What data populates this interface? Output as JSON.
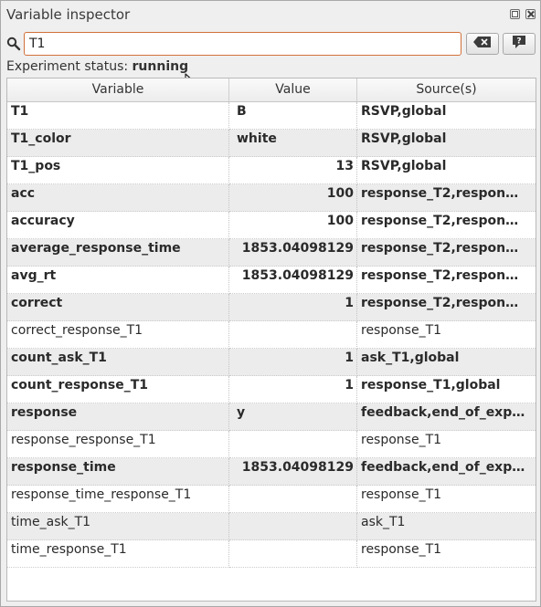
{
  "window": {
    "title": "Variable inspector"
  },
  "search": {
    "value": "T1"
  },
  "status": {
    "label": "Experiment status:",
    "value": "running"
  },
  "table": {
    "headers": [
      "Variable",
      "Value",
      "Source(s)"
    ],
    "rows": [
      {
        "variable": "T1",
        "value": "B",
        "sources": "RSVP,global",
        "bold": true,
        "numeric": false
      },
      {
        "variable": "T1_color",
        "value": "white",
        "sources": "RSVP,global",
        "bold": true,
        "numeric": false
      },
      {
        "variable": "T1_pos",
        "value": "13",
        "sources": "RSVP,global",
        "bold": true,
        "numeric": true
      },
      {
        "variable": "acc",
        "value": "100",
        "sources": "response_T2,respon…",
        "bold": true,
        "numeric": true
      },
      {
        "variable": "accuracy",
        "value": "100",
        "sources": "response_T2,respon…",
        "bold": true,
        "numeric": true
      },
      {
        "variable": "average_response_time",
        "value": "1853.04098129",
        "sources": "response_T2,respon…",
        "bold": true,
        "numeric": true
      },
      {
        "variable": "avg_rt",
        "value": "1853.04098129",
        "sources": "response_T2,respon…",
        "bold": true,
        "numeric": true
      },
      {
        "variable": "correct",
        "value": "1",
        "sources": "response_T2,respon…",
        "bold": true,
        "numeric": true
      },
      {
        "variable": "correct_response_T1",
        "value": "",
        "sources": "response_T1",
        "bold": false,
        "numeric": false
      },
      {
        "variable": "count_ask_T1",
        "value": "1",
        "sources": "ask_T1,global",
        "bold": true,
        "numeric": true
      },
      {
        "variable": "count_response_T1",
        "value": "1",
        "sources": "response_T1,global",
        "bold": true,
        "numeric": true
      },
      {
        "variable": "response",
        "value": "y",
        "sources": "feedback,end_of_exp…",
        "bold": true,
        "numeric": false
      },
      {
        "variable": "response_response_T1",
        "value": "",
        "sources": "response_T1",
        "bold": false,
        "numeric": false
      },
      {
        "variable": "response_time",
        "value": "1853.04098129",
        "sources": "feedback,end_of_exp…",
        "bold": true,
        "numeric": true
      },
      {
        "variable": "response_time_response_T1",
        "value": "",
        "sources": "response_T1",
        "bold": false,
        "numeric": false
      },
      {
        "variable": "time_ask_T1",
        "value": "",
        "sources": "ask_T1",
        "bold": false,
        "numeric": false
      },
      {
        "variable": "time_response_T1",
        "value": "",
        "sources": "response_T1",
        "bold": false,
        "numeric": false
      }
    ]
  },
  "icons": {
    "search": "magnifier-icon",
    "clear": "clear-text-icon",
    "help": "help-icon",
    "float": "float-window-icon",
    "close": "close-icon"
  },
  "colors": {
    "search_border": "#d2713a",
    "alt_row": "#ececec"
  }
}
